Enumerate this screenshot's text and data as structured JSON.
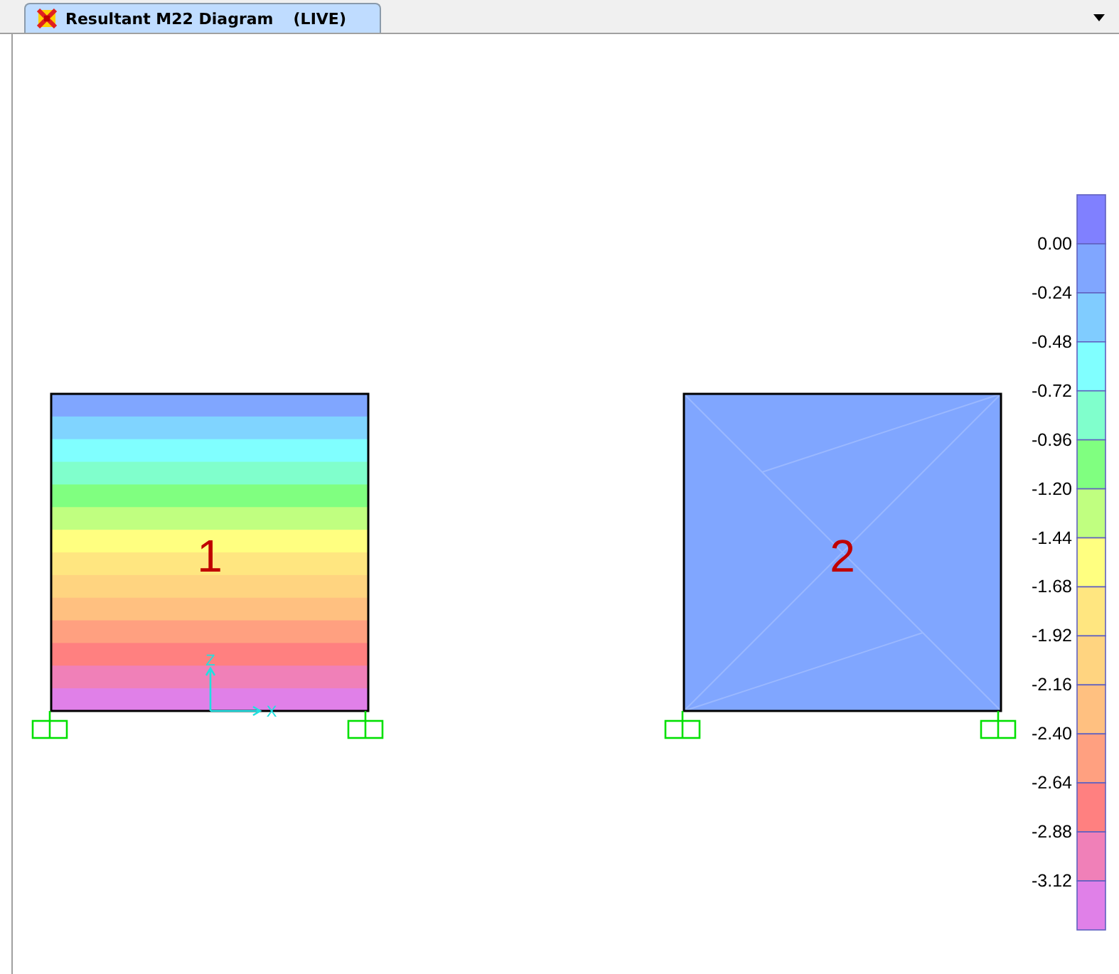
{
  "tab": {
    "title": "Resultant M22 Diagram",
    "suffix": "(LIVE)",
    "selected": true
  },
  "plates": [
    {
      "kind": "banded",
      "label": "1",
      "axes": {
        "vertical": "Z",
        "horizontal": "X"
      },
      "stripes": [
        {
          "color": "#80a6ff"
        },
        {
          "color": "#80d4ff"
        },
        {
          "color": "#80ffff"
        },
        {
          "color": "#80ffcc"
        },
        {
          "color": "#80ff80"
        },
        {
          "color": "#c0ff80"
        },
        {
          "color": "#ffff80"
        },
        {
          "color": "#ffe680"
        },
        {
          "color": "#ffd480"
        },
        {
          "color": "#ffc080"
        },
        {
          "color": "#ffa080"
        },
        {
          "color": "#ff8080"
        },
        {
          "color": "#f080b8"
        },
        {
          "color": "#e080e8"
        }
      ]
    },
    {
      "kind": "solid",
      "label": "2",
      "color": "#80a6ff"
    }
  ],
  "legend": {
    "bands": [
      {
        "color": "#8080ff"
      },
      {
        "color": "#80a6ff"
      },
      {
        "color": "#80ccff"
      },
      {
        "color": "#80ffff"
      },
      {
        "color": "#80ffcc"
      },
      {
        "color": "#80ff80"
      },
      {
        "color": "#c0ff80"
      },
      {
        "color": "#ffff80"
      },
      {
        "color": "#ffe680"
      },
      {
        "color": "#ffd480"
      },
      {
        "color": "#ffc080"
      },
      {
        "color": "#ffa080"
      },
      {
        "color": "#ff8080"
      },
      {
        "color": "#f080b8"
      },
      {
        "color": "#e080e8"
      }
    ],
    "labels": [
      "0.00",
      "-0.24",
      "-0.48",
      "-0.72",
      "-0.96",
      "-1.20",
      "-1.44",
      "-1.68",
      "-1.92",
      "-2.16",
      "-2.40",
      "-2.64",
      "-2.88",
      "-3.12"
    ]
  }
}
